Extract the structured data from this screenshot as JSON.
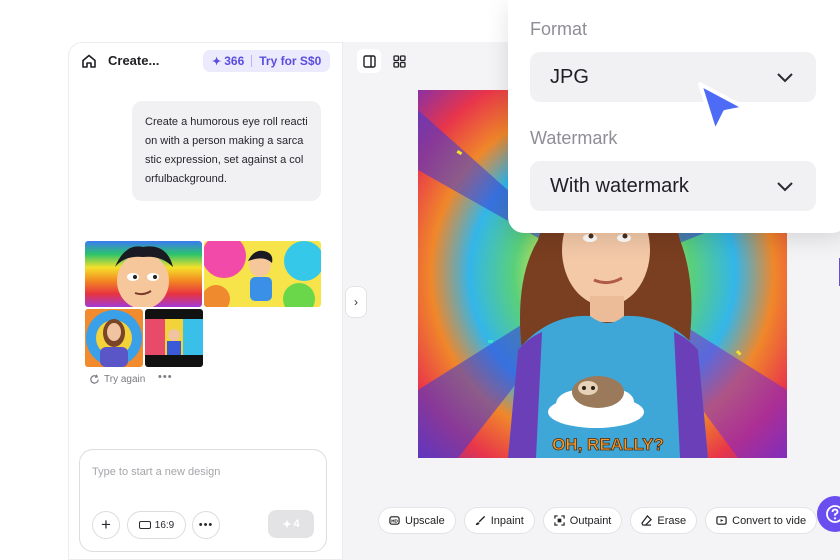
{
  "header": {
    "title": "Create...",
    "credits": "366",
    "try_label": "Try for S$0"
  },
  "chat": {
    "prompt": "Create a humorous eye roll reaction with a person making a sarcastic expression, set against a colorfulbackground.",
    "try_again": "Try again"
  },
  "composer": {
    "placeholder": "Type to start a new design",
    "ratio": "16:9",
    "cost": "4"
  },
  "canvas": {
    "shirt_text": "OH, REALLY?"
  },
  "actions": [
    {
      "label": "Upscale",
      "icon": "upscale-icon"
    },
    {
      "label": "Inpaint",
      "icon": "brush-icon"
    },
    {
      "label": "Outpaint",
      "icon": "outpaint-icon"
    },
    {
      "label": "Erase",
      "icon": "eraser-icon"
    },
    {
      "label": "Convert to vide",
      "icon": "video-icon"
    }
  ],
  "popup": {
    "format_label": "Format",
    "format_value": "JPG",
    "watermark_label": "Watermark",
    "watermark_value": "With watermark"
  },
  "colors": {
    "accent": "#5a4de0",
    "pill_bg": "#eceafd",
    "cursor": "#4d6bf5",
    "help": "#6b4ef0"
  }
}
